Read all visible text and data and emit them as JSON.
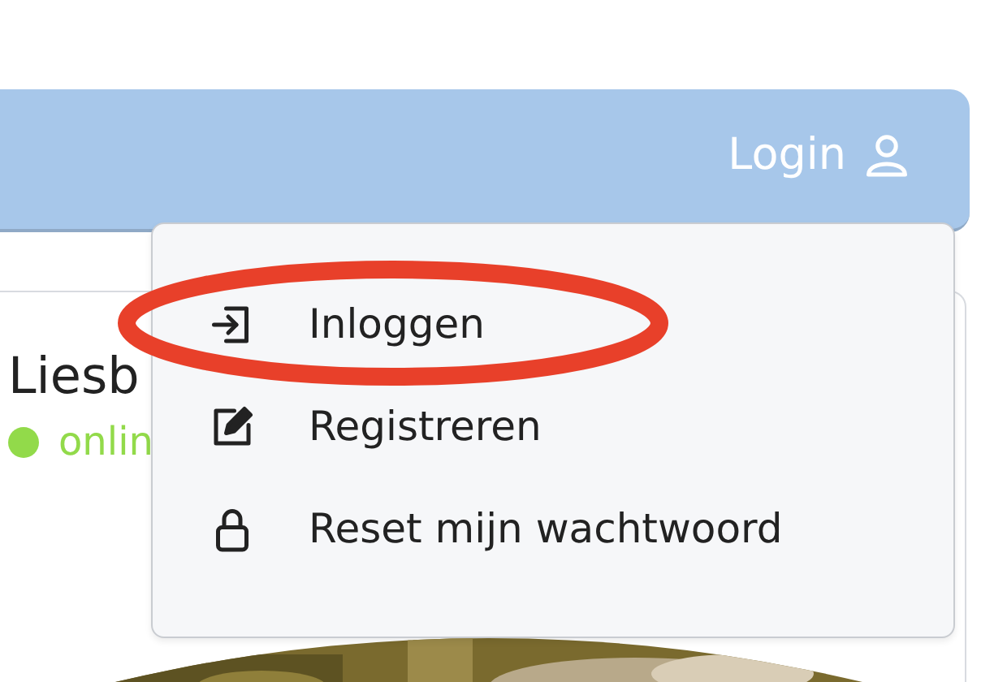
{
  "navbar": {
    "login_label": "Login"
  },
  "profile": {
    "name": "Liesb",
    "status": "onlin",
    "online": true
  },
  "menu": {
    "items": [
      {
        "kind": "login",
        "label": "Inloggen",
        "highlighted": true
      },
      {
        "kind": "register",
        "label": "Registreren",
        "highlighted": false
      },
      {
        "kind": "reset",
        "label": "Reset mijn wachtwoord",
        "highlighted": false
      }
    ]
  }
}
